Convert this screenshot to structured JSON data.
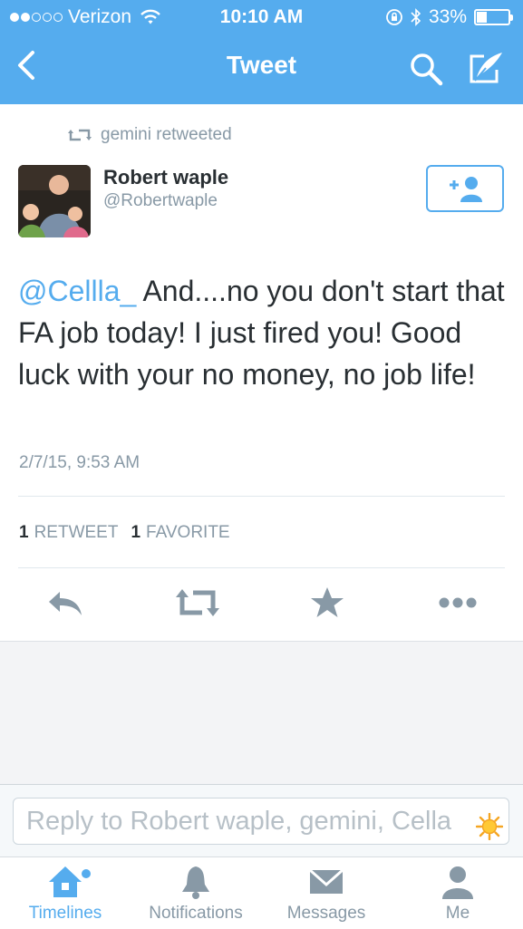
{
  "status_bar": {
    "carrier": "Verizon",
    "time": "10:10 AM",
    "battery": "33%",
    "battery_level": 0.33,
    "signal_bars_filled": 2,
    "signal_bars_total": 5
  },
  "nav": {
    "title": "Tweet",
    "back_icon": "chevron-left-icon",
    "search_icon": "search-icon",
    "compose_icon": "compose-icon"
  },
  "tweet": {
    "retweeted_by": "gemini retweeted",
    "author_name": "Robert waple",
    "author_handle": "@Robertwaple",
    "mention": "@Cellla_",
    "body": " And....no you don't start that FA job today!  I just fired you! Good luck with your no money, no job life!",
    "timestamp": "2/7/15, 9:53 AM",
    "retweet_count": "1",
    "retweet_label": "RETWEET",
    "favorite_count": "1",
    "favorite_label": "FAVORITE"
  },
  "reply": {
    "placeholder": "Reply to Robert waple, gemini, Cella"
  },
  "tabs": [
    {
      "label": "Timelines",
      "icon": "home-icon",
      "active": true
    },
    {
      "label": "Notifications",
      "icon": "bell-icon",
      "active": false
    },
    {
      "label": "Messages",
      "icon": "envelope-icon",
      "active": false
    },
    {
      "label": "Me",
      "icon": "person-icon",
      "active": false
    }
  ],
  "colors": {
    "brand": "#55acee",
    "text": "#292f33",
    "muted": "#8899a6"
  }
}
